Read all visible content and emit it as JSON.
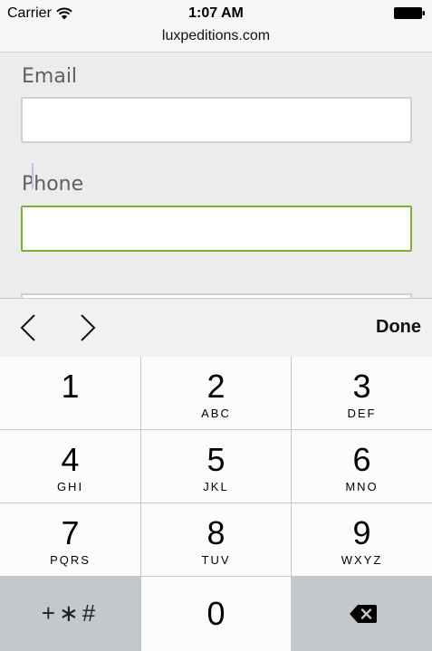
{
  "status_bar": {
    "carrier": "Carrier",
    "time": "1:07 AM",
    "url": "luxpeditions.com",
    "icons": [
      "wifi-icon",
      "battery-icon"
    ]
  },
  "form": {
    "email_label": "Email",
    "email_value": "",
    "phone_label": "Phone",
    "phone_value": "",
    "focused_field": "phone",
    "accent_color": "#7eb12e"
  },
  "accessory_bar": {
    "done_label": "Done",
    "icons": [
      "chevron-left-icon",
      "chevron-right-icon"
    ]
  },
  "keypad": {
    "keys": [
      {
        "digit": "1",
        "letters": ""
      },
      {
        "digit": "2",
        "letters": "ABC"
      },
      {
        "digit": "3",
        "letters": "DEF"
      },
      {
        "digit": "4",
        "letters": "GHI"
      },
      {
        "digit": "5",
        "letters": "JKL"
      },
      {
        "digit": "6",
        "letters": "MNO"
      },
      {
        "digit": "7",
        "letters": "PQRS"
      },
      {
        "digit": "8",
        "letters": "TUV"
      },
      {
        "digit": "9",
        "letters": "WXYZ"
      }
    ],
    "symbols_label": "+∗#",
    "zero": "0",
    "delete_icon": "delete-backspace-icon"
  }
}
